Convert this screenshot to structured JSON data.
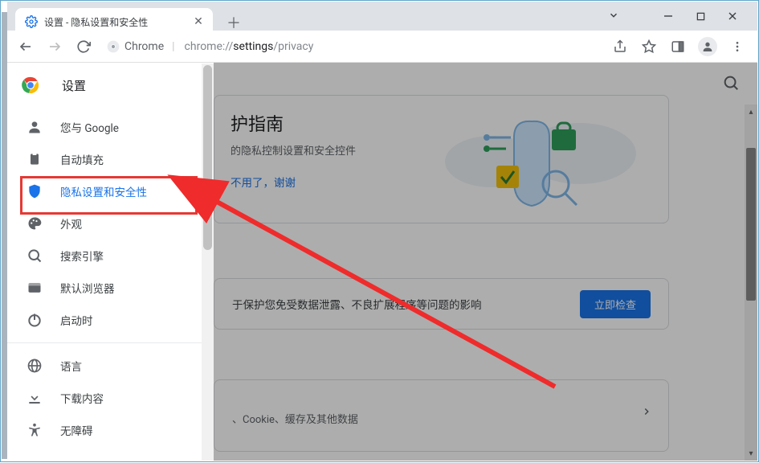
{
  "window": {
    "tab_title": "设置 - 隐私设置和安全性"
  },
  "toolbar": {
    "site_label": "Chrome",
    "url_dim1": "chrome://",
    "url_strong": "settings",
    "url_dim2": "/privacy"
  },
  "sidebar": {
    "head_title": "设置",
    "items": [
      {
        "label": "您与 Google"
      },
      {
        "label": "自动填充"
      },
      {
        "label": "隐私设置和安全性"
      },
      {
        "label": "外观"
      },
      {
        "label": "搜索引擎"
      },
      {
        "label": "默认浏览器"
      },
      {
        "label": "启动时"
      }
    ],
    "items2": [
      {
        "label": "语言"
      },
      {
        "label": "下载内容"
      },
      {
        "label": "无障碍"
      }
    ]
  },
  "header": {
    "search_title": "搜索"
  },
  "guide": {
    "title": "护指南",
    "subtitle": "的隐私控制设置和安全控件",
    "dismiss": "不用了，谢谢"
  },
  "check": {
    "text": "于保护您免受数据泄露、不良扩展程序等问题的影响",
    "button": "立即检查"
  },
  "datacard": {
    "subtitle": "、Cookie、缓存及其他数据"
  }
}
